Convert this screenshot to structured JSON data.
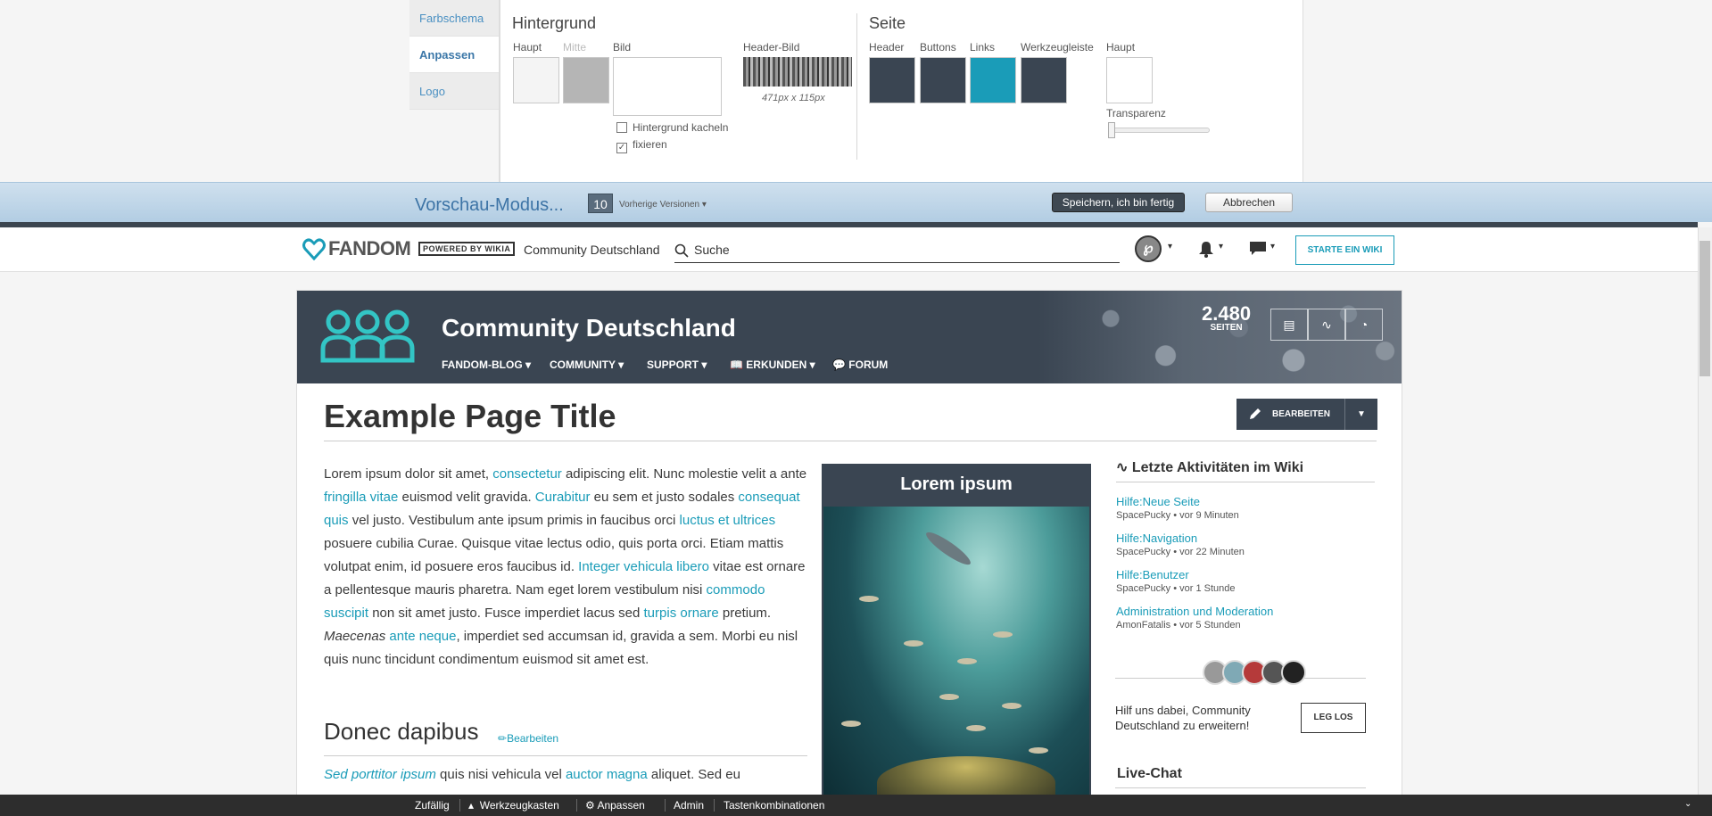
{
  "designer": {
    "tabs": [
      {
        "label": "Farbschema"
      },
      {
        "label": "Anpassen"
      },
      {
        "label": "Logo"
      }
    ],
    "background_section": {
      "title": "Hintergrund",
      "labels": {
        "main": "Haupt",
        "middle": "Mitte",
        "image": "Bild",
        "header_image": "Header-Bild"
      },
      "header_image_size": "471px x 115px",
      "options": [
        {
          "label": "Hintergrund kacheln",
          "checked": false
        },
        {
          "label": "fixieren",
          "checked": true
        }
      ],
      "colors": {
        "main": "#f4f4f4",
        "middle": "#b5b5b5"
      }
    },
    "page_section": {
      "title": "Seite",
      "labels": {
        "header": "Header",
        "buttons": "Buttons",
        "links": "Links",
        "toolbar": "Werkzeugleiste",
        "main": "Haupt",
        "transparency": "Transparenz"
      },
      "colors": {
        "header": "#3a4552",
        "buttons": "#3a4552",
        "links": "#1a9cb8",
        "toolbar": "#3a4552",
        "main": "#ffffff"
      }
    }
  },
  "preview_bar": {
    "title": "Vorschau-Modus...",
    "version_count": "10",
    "previous_versions": "Vorherige Versionen",
    "save_label": "Speichern, ich bin fertig",
    "cancel_label": "Abbrechen"
  },
  "global_nav": {
    "logo": "FANDOM",
    "powered_by": "POWERED BY WIKIA",
    "community": "Community Deutschland",
    "search_placeholder": "Suche",
    "start_wiki": "STARTE EIN WIKI",
    "avatar_letter": "℘"
  },
  "wiki": {
    "name": "Community Deutschland",
    "nav": [
      "FANDOM-BLOG",
      "COMMUNITY",
      "SUPPORT",
      "ERKUNDEN",
      "FORUM"
    ],
    "page_count": "2.480",
    "page_count_label": "SEITEN",
    "page_title": "Example Page Title",
    "edit_label": "BEARBEITEN",
    "section_title": "Donec dapibus",
    "section_edit": "Bearbeiten",
    "infobox_title": "Lorem ipsum"
  },
  "rail": {
    "activity_title": "Letzte Aktivitäten im Wiki",
    "activities": [
      {
        "title": "Hilfe:Neue Seite",
        "meta": "SpacePucky • vor 9 Minuten"
      },
      {
        "title": "Hilfe:Navigation",
        "meta": "SpacePucky • vor 22 Minuten"
      },
      {
        "title": "Hilfe:Benutzer",
        "meta": "SpacePucky • vor 1 Stunde"
      },
      {
        "title": "Administration und Moderation",
        "meta": "AmonFatalis • vor 5 Stunden"
      }
    ],
    "help_text": "Hilf uns dabei, Community Deutschland zu erweitern!",
    "help_button": "LEG LOS",
    "livechat": "Live-Chat"
  },
  "toolbar": {
    "items": [
      "Zufällig",
      "Werkzeugkasten",
      "Anpassen",
      "Admin",
      "Tastenkombinationen"
    ]
  },
  "colors": {
    "accent": "#1a9cb8",
    "dark": "#3a4552"
  }
}
